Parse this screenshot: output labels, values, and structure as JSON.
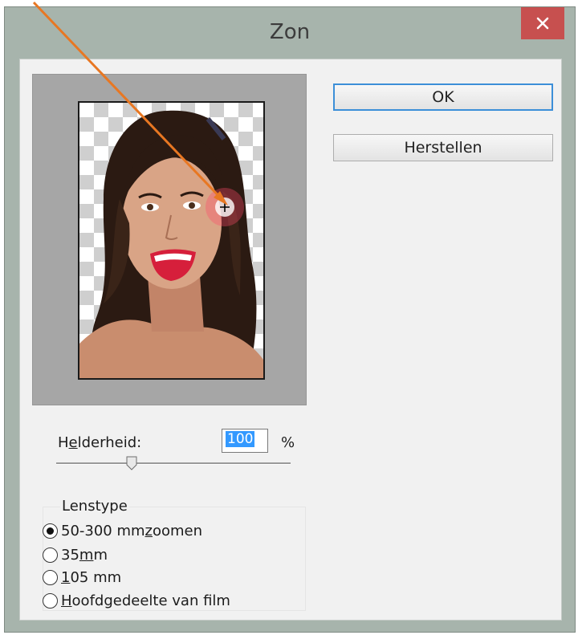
{
  "dialog": {
    "title": "Zon",
    "close_glyph": "✕",
    "accent_color": "#3c8fd8",
    "close_color": "#c7504f"
  },
  "buttons": {
    "ok_label": "OK",
    "reset_label": "Herstellen"
  },
  "brightness": {
    "label_pre": "H",
    "label_underlined": "e",
    "label_post": "lderheid:",
    "value": "100",
    "unit": "%",
    "slider_value_percent": 100
  },
  "lens_type": {
    "legend": "Lenstype",
    "options": [
      {
        "pre": "50-300 mm ",
        "ul": "z",
        "post": "oomen",
        "checked": true
      },
      {
        "pre": "35 ",
        "ul": "m",
        "post": "m",
        "checked": false
      },
      {
        "pre": "",
        "ul": "1",
        "post": "05 mm",
        "checked": false
      },
      {
        "pre": "",
        "ul": "H",
        "post": "oofdgedeelte van film",
        "checked": false
      }
    ]
  },
  "preview": {
    "icon": "lens-flare-center-crosshair"
  },
  "annotation": {
    "arrow_color": "#e87722"
  }
}
